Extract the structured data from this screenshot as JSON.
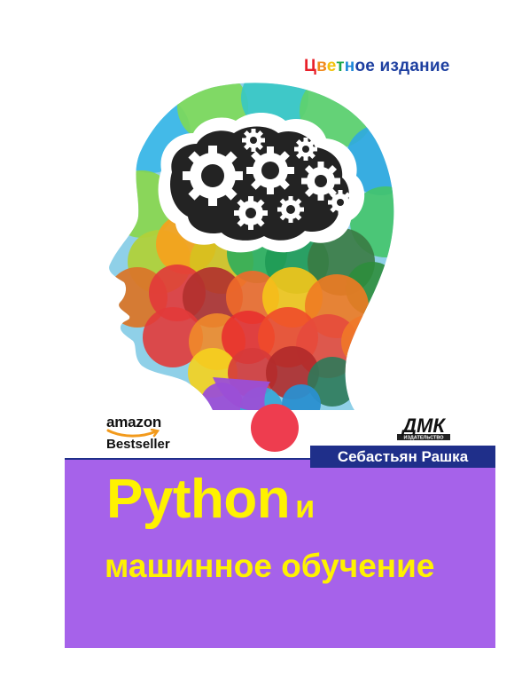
{
  "edition": {
    "letters": [
      {
        "text": "Ц",
        "color": "#e8202a"
      },
      {
        "text": "в",
        "color": "#f08a1c"
      },
      {
        "text": "е",
        "color": "#f2c20c"
      },
      {
        "text": "т",
        "color": "#1aa64a"
      },
      {
        "text": "н",
        "color": "#1d87d9"
      },
      {
        "text": "о",
        "color": "#1d3fa0"
      },
      {
        "text": "е",
        "color": "#1d3fa0"
      },
      {
        "text": " ",
        "color": "#1d3fa0"
      },
      {
        "text": "и",
        "color": "#1d3fa0"
      },
      {
        "text": "з",
        "color": "#1d3fa0"
      },
      {
        "text": "д",
        "color": "#1d3fa0"
      },
      {
        "text": "а",
        "color": "#1d3fa0"
      },
      {
        "text": "н",
        "color": "#1d3fa0"
      },
      {
        "text": "и",
        "color": "#1d3fa0"
      },
      {
        "text": "е",
        "color": "#1d3fa0"
      }
    ]
  },
  "amazon": {
    "brand": "amazon",
    "subtitle": "Bestseller"
  },
  "publisher": {
    "logo_text": "ДМК",
    "logo_subtext": "ИЗДАТЕЛЬСТВО"
  },
  "author": "Себастьян Рашка",
  "title": {
    "main": "Python",
    "conjunction": "и",
    "subtitle": "машинное обучение"
  },
  "colors": {
    "purple_panel": "#a662ea",
    "title_yellow": "#fff200",
    "author_blue": "#1f2f8a",
    "brain_dark": "#232323",
    "bubble_red": "#ee3d4f"
  }
}
